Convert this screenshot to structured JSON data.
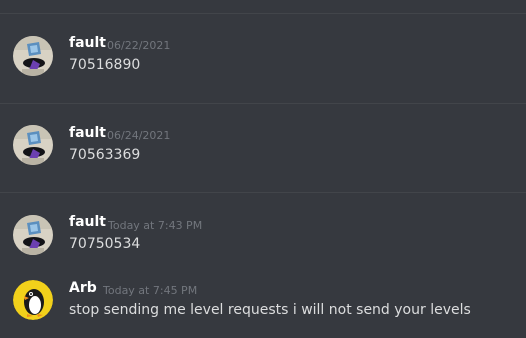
{
  "colors": {
    "background": "#36393f",
    "divider": "#42454a",
    "author": "#ffffff",
    "timestamp": "#72767d",
    "text": "#dcddde"
  },
  "messages": [
    {
      "author": "fault",
      "timestamp": "06/22/2021",
      "content": "70516890",
      "avatar_icon": "penguin-avatar-blue"
    },
    {
      "author": "fault",
      "timestamp": "06/24/2021",
      "content": "70563369",
      "avatar_icon": "penguin-avatar-blue"
    },
    {
      "author": "fault",
      "timestamp": "Today at 7:43 PM",
      "content": "70750534",
      "avatar_icon": "penguin-avatar-blue"
    },
    {
      "author": "Arb",
      "timestamp": "Today at 7:45 PM",
      "content": "stop sending me level requests i will not send your levels",
      "avatar_icon": "penguin-avatar-yellow"
    }
  ]
}
